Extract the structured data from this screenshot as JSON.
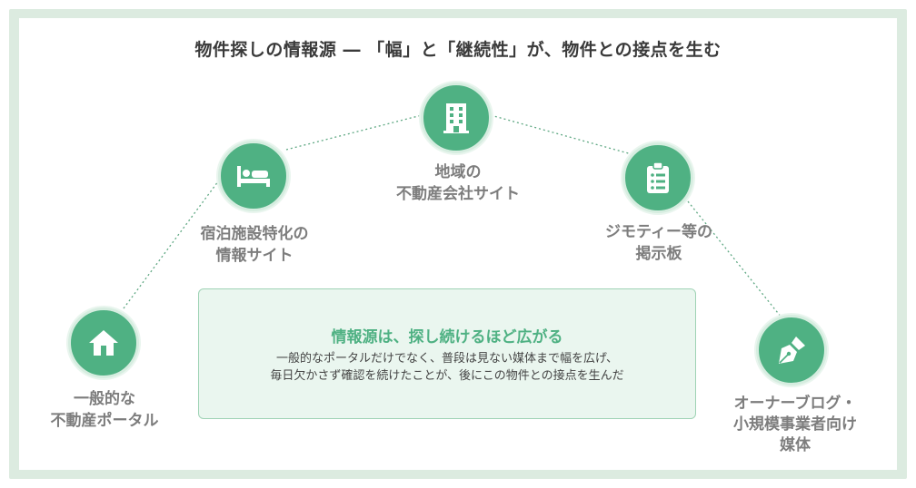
{
  "title": "物件探しの情報源 ― 「幅」と「継続性」が、物件との接点を生む",
  "nodes": {
    "portal": {
      "label1": "一般的な",
      "label2": "不動産ポータル",
      "icon": "house-icon"
    },
    "lodging": {
      "label1": "宿泊施設特化の",
      "label2": "情報サイト",
      "icon": "bed-icon"
    },
    "local": {
      "label1": "地域の",
      "label2": "不動産会社サイト",
      "icon": "building-icon"
    },
    "board": {
      "label1": "ジモティー等の",
      "label2": "掲示板",
      "icon": "clipboard-icon"
    },
    "owner": {
      "label1": "オーナーブログ・",
      "label2": "小規模事業者向け",
      "label3": "媒体",
      "icon": "pen-nib-icon"
    }
  },
  "center": {
    "heading": "情報源は、探し続けるほど広がる",
    "line1": "一般的なポータルだけでなく、普段は見ない媒体まで幅を広げ、",
    "line2": "毎日欠かさず確認を続けたことが、後にこの物件との接点を生んだ"
  },
  "colors": {
    "accent": "#4fb183",
    "frame": "#dcebe0",
    "box_bg": "#eaf6ef",
    "label": "#7d7d7d"
  }
}
